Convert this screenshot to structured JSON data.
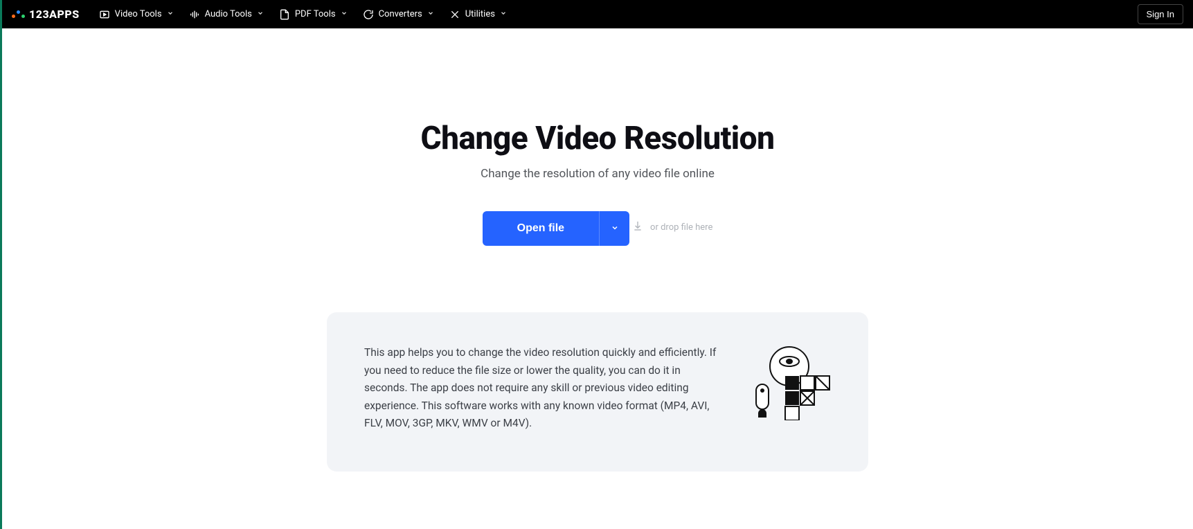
{
  "brand": "123APPS",
  "nav": {
    "items": [
      {
        "label": "Video Tools"
      },
      {
        "label": "Audio Tools"
      },
      {
        "label": "PDF Tools"
      },
      {
        "label": "Converters"
      },
      {
        "label": "Utilities"
      }
    ],
    "signIn": "Sign In"
  },
  "hero": {
    "title": "Change Video Resolution",
    "subtitle": "Change the resolution of any video file online",
    "openFile": "Open file",
    "dropHint": "or drop file here"
  },
  "info": {
    "text": "This app helps you to change the video resolution quickly and efficiently. If you need to reduce the file size or lower the quality, you can do it in seconds. The app does not require any skill or previous video editing experience. This software works with any known video format (MP4, AVI, FLV, MOV, 3GP, MKV, WMV or M4V)."
  }
}
